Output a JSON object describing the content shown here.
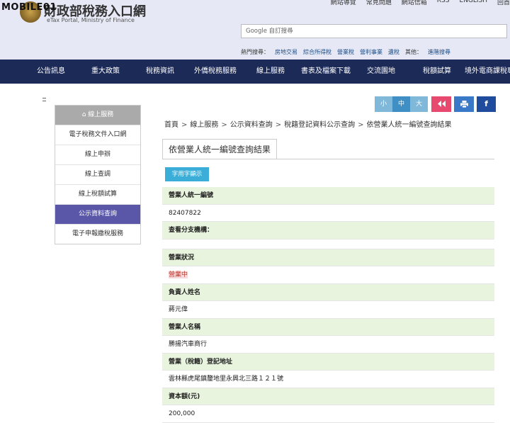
{
  "watermark": "MOBILE01",
  "site": {
    "title": "財政部稅務入口網",
    "subtitle": "eTax Portal, Ministry of Finance"
  },
  "top_links": [
    "網站導覽",
    "常見問題",
    "網站信箱",
    "RSS",
    "ENGLISH",
    "回首"
  ],
  "search": {
    "placeholder": "Google 自訂搜尋"
  },
  "hot_search": {
    "label": "熱門搜尋：",
    "items": [
      "房地交易",
      "綜合所得稅",
      "營業稅",
      "營利事業",
      "遺稅"
    ],
    "other_label": "其他：",
    "other_link": "進階搜尋"
  },
  "main_nav": [
    "公告訊息",
    "重大政策",
    "稅務資訊",
    "外僑稅務服務",
    "線上服務",
    "書表及檔案下載",
    "交流園地",
    "稅額試算",
    "境外電商課稅專"
  ],
  "sidebar": {
    "header": "線上服務",
    "items": [
      "電子稅務文件入口網",
      "線上申辦",
      "線上查調",
      "線上稅額試算",
      "公示資料查詢",
      "電子申報繳稅服務"
    ],
    "active_index": 4
  },
  "tools": {
    "font_small": "小",
    "font_mid": "中",
    "font_large": "大",
    "colors": {
      "font": "#7fb8d8",
      "font_active": "#3f8fc4",
      "back": "#e84a6f",
      "print": "#3a79c8",
      "facebook": "#1f4c9c"
    }
  },
  "breadcrumb": [
    "首頁",
    "線上服務",
    "公示資料查詢",
    "稅籍登記資料公示查詢",
    "依營業人統一編號查詢結果"
  ],
  "result": {
    "tab_title": "依營業人統一編號查詢結果",
    "word_button": "字用字顯示",
    "rows": [
      {
        "label": "營業人統一編號",
        "value": "82407822"
      },
      {
        "label": "查看分支機構：",
        "value": ""
      },
      {
        "label": "營業狀況",
        "value": "營業中",
        "status": true
      },
      {
        "label": "負責人姓名",
        "value": "蔣元偉"
      },
      {
        "label": "營業人名稱",
        "value": "勝揚汽車商行"
      },
      {
        "label": "營業（稅籍）登記地址",
        "value": "雲林縣虎尾鎮釐地里永興北三路１２１號"
      },
      {
        "label": "資本額(元)",
        "value": "200,000"
      }
    ]
  }
}
